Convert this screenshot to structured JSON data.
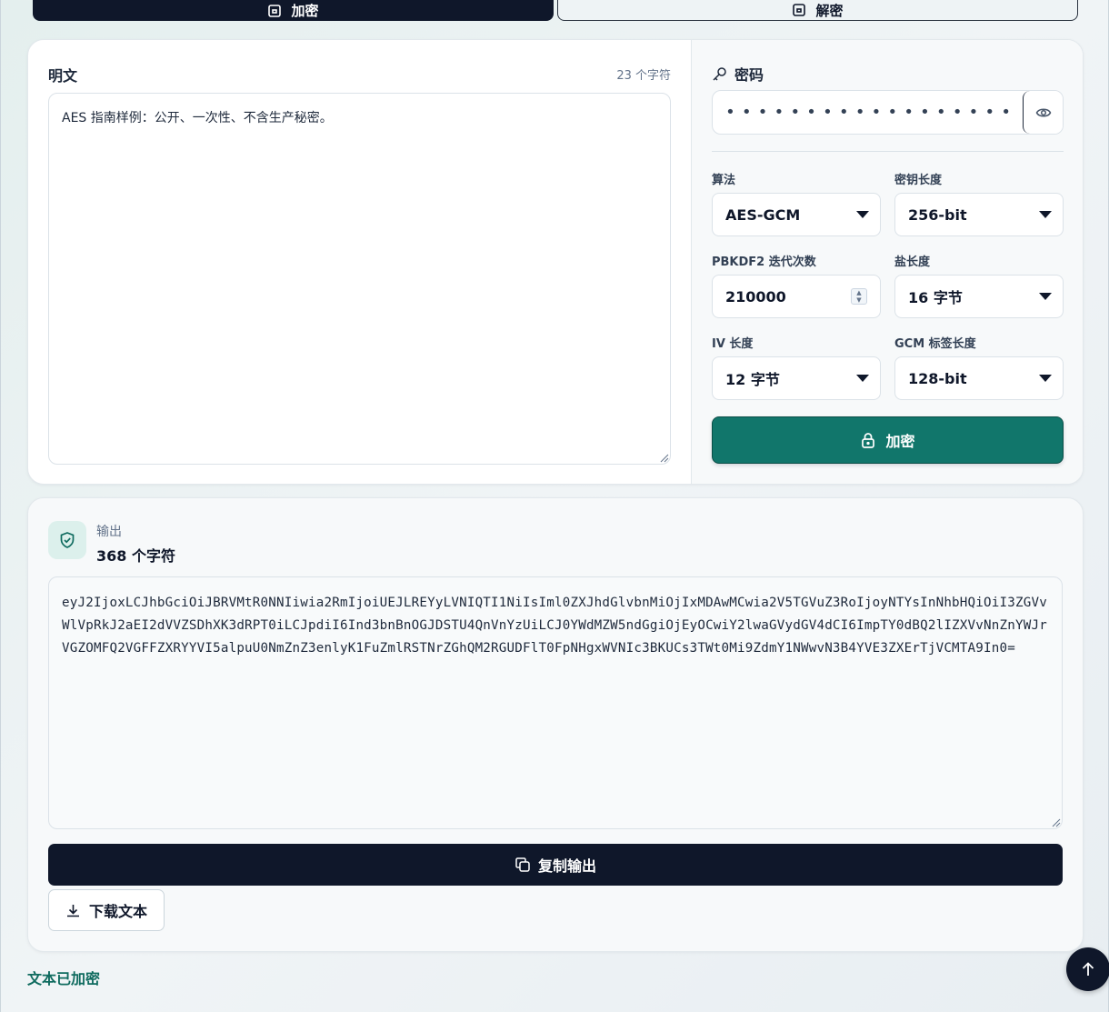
{
  "mode_tabs": {
    "encrypt_label": "加密",
    "decrypt_label": "解密"
  },
  "plaintext": {
    "title": "明文",
    "char_count": "23 个字符",
    "value": "AES 指南样例：公开、一次性、不含生产秘密。"
  },
  "password": {
    "label": "密码",
    "value": "••••••••••••••••••••••"
  },
  "settings": {
    "algorithm_label": "算法",
    "algorithm_value": "AES-GCM",
    "key_length_label": "密钥长度",
    "key_length_value": "256-bit",
    "iterations_label": "PBKDF2 迭代次数",
    "iterations_value": "210000",
    "salt_label": "盐长度",
    "salt_value": "16 字节",
    "iv_label": "IV 长度",
    "iv_value": "12 字节",
    "tag_label": "GCM 标签长度",
    "tag_value": "128-bit"
  },
  "encrypt_button_label": "加密",
  "output": {
    "label": "输出",
    "char_count": "368 个字符",
    "value": "eyJ2IjoxLCJhbGciOiJBRVMtR0NNIiwia2RmIjoiUEJLREYyLVNIQTI1NiIsIml0ZXJhdGlvbnMiOjIxMDAwMCwia2V5TGVuZ3RoIjoyNTYsInNhbHQiOiI3ZGVvWlVpRkJ2aEI2dVVZSDhXK3dRPT0iLCJpdiI6Ind3bnBnOGJDSTU4QnVnYzUiLCJ0YWdMZW5ndGgiOjEyOCwiY2lwaGVydGV4dCI6ImpTY0dBQ2lIZXVvNnZnYWJrVGZOMFQ2VGFFZXRYYVI5alpuU0NmZnZ3enlyK1FuZmlRSTNrZGhQM2RGUDFlT0FpNHgxWVNIc3BKUCs3TWt0Mi9ZdmY1NWwvN3B4YVE3ZXErTjVCMTA9In0="
  },
  "copy_button_label": "复制输出",
  "download_button_label": "下载文本",
  "status_text": "文本已加密",
  "colors": {
    "primary_dark": "#0f172a",
    "accent_teal": "#11766b",
    "status_green": "#0f6b5f"
  },
  "icons": {
    "mode_encrypt": "lock-square-icon",
    "mode_decrypt": "unlock-square-icon",
    "password": "key-icon",
    "toggle_visibility": "eye-icon",
    "encrypt": "lock-icon",
    "output": "shield-check-icon",
    "copy": "copy-icon",
    "download": "download-icon",
    "scroll_top": "arrow-up-icon"
  }
}
